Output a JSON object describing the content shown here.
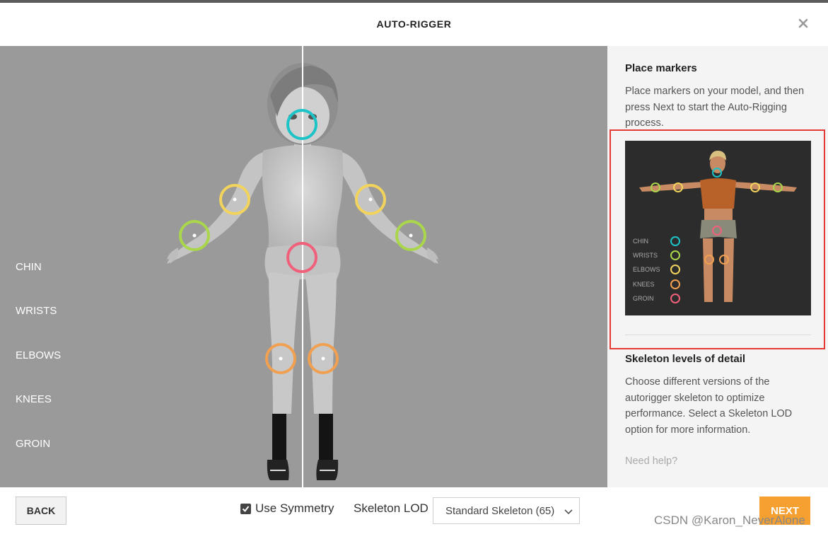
{
  "app": {
    "title": "AUTO-RIGGER",
    "close_icon": "close-icon"
  },
  "viewport": {
    "markers": [
      "CHIN",
      "WRISTS",
      "ELBOWS",
      "KNEES",
      "GROIN"
    ],
    "marker_colors": {
      "chin": "#1cc3c7",
      "elbows": "#f2d45c",
      "wrists": "#a9d64a",
      "groin": "#f0607a",
      "knees": "#f0a050"
    }
  },
  "sidebar": {
    "heading": "Place markers",
    "description": "Place markers on your model, and then press Next to start the Auto-Rigging process.",
    "preview_markers": [
      "CHIN",
      "WRISTS",
      "ELBOWS",
      "KNEES",
      "GROIN"
    ],
    "lod_heading": "Skeleton levels of detail",
    "lod_description": "Choose different versions of the autorigger skeleton to optimize performance. Select a Skeleton LOD option for more information.",
    "help_link": "Need help?"
  },
  "footer": {
    "back_label": "BACK",
    "symmetry_label": "Use Symmetry",
    "symmetry_checked": true,
    "lod_label": "Skeleton LOD",
    "lod_value": "Standard Skeleton (65)",
    "next_label": "NEXT",
    "watermark": "CSDN @Karon_NeverAlone"
  },
  "colors": {
    "accent": "#f5a030",
    "viewport_bg": "#9a9a9a",
    "highlight_border": "#e53935"
  }
}
